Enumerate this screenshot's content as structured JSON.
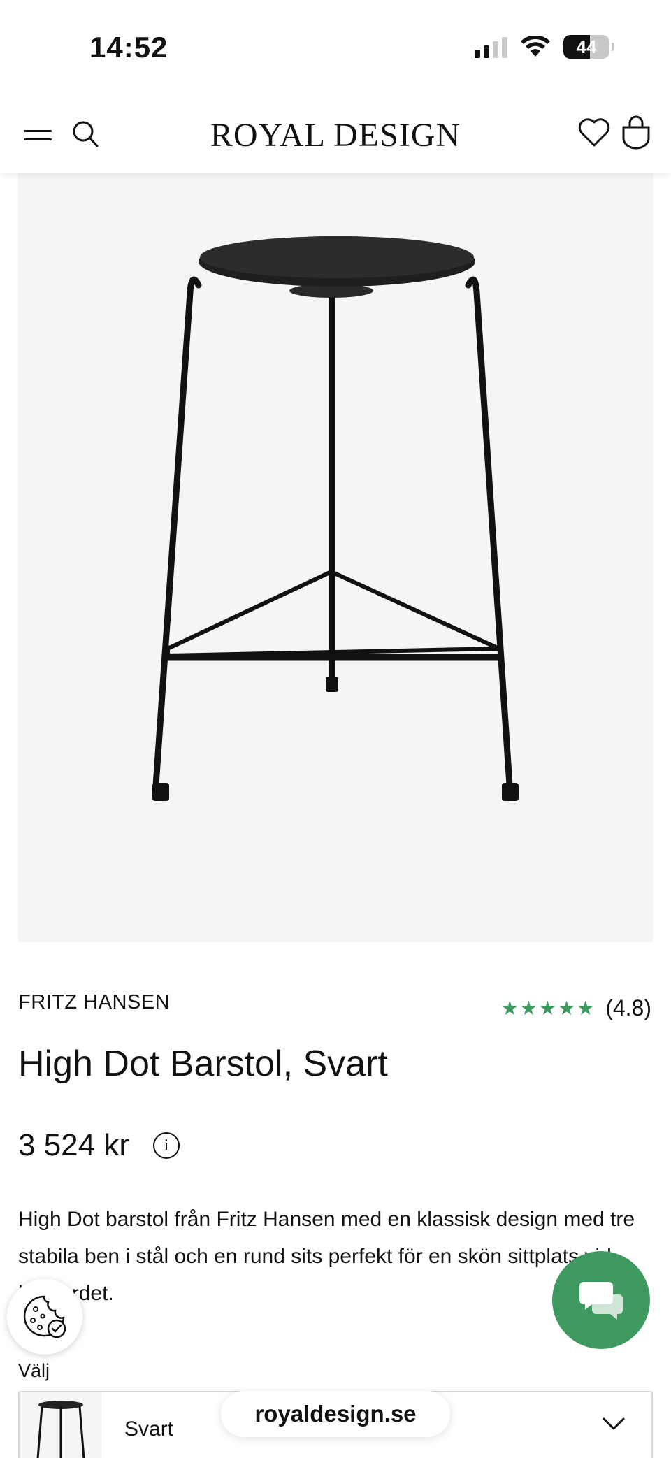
{
  "status_bar": {
    "time": "14:52",
    "battery": "44"
  },
  "header": {
    "logo": "ROYAL DESIGN"
  },
  "product": {
    "brand": "FRITZ HANSEN",
    "rating_stars": "★★★★★",
    "rating_value": "(4.8)",
    "title": "High Dot Barstol, Svart",
    "price": "3 524 kr",
    "info_symbol": "i",
    "description": "High Dot barstol från Fritz Hansen med en klassisk design med tre stabila ben i stål och en rund sits perfekt för en skön sittplats vid barbordet."
  },
  "variant": {
    "label": "Välj",
    "selected": "Svart"
  },
  "browser": {
    "url": "royaldesign.se"
  },
  "colors": {
    "accent": "#3f9a60",
    "image_bg": "#f5f5f5"
  },
  "icons": [
    "menu-icon",
    "search-icon",
    "heart-icon",
    "bag-icon",
    "info-icon",
    "cookie-icon",
    "chat-icon",
    "chevron-down-icon"
  ]
}
